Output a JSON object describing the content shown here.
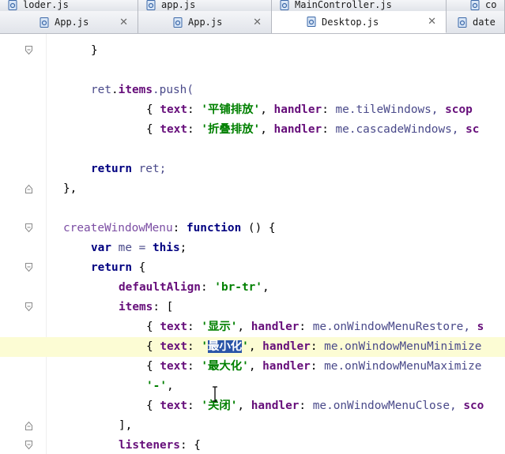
{
  "tabs_top": [
    {
      "label": "loder.js"
    },
    {
      "label": "app.js"
    },
    {
      "label": "MainController.js"
    },
    {
      "label": "co"
    }
  ],
  "tabs": [
    {
      "label": "App.js",
      "close": "✕"
    },
    {
      "label": "App.js",
      "close": "✕"
    },
    {
      "label": "Desktop.js",
      "close": "✕",
      "active": true
    },
    {
      "label": "date"
    }
  ],
  "code": {
    "l1": {
      "a": "}"
    },
    "l3": {
      "a": "ret",
      "b": ".",
      "c": "items",
      "d": ".push("
    },
    "l4": {
      "a": "{ ",
      "b": "text",
      "c": ": ",
      "d": "'平铺排放'",
      "e": ", ",
      "f": "handler",
      "g": ": ",
      "h": "me",
      "i": ".tileWindows, ",
      "j": "scop"
    },
    "l5": {
      "a": "{ ",
      "b": "text",
      "c": ": ",
      "d": "'折叠排放'",
      "e": ", ",
      "f": "handler",
      "g": ": ",
      "h": "me",
      "i": ".cascadeWindows, ",
      "j": "sc"
    },
    "l7": {
      "a": "return",
      "b": " ret;"
    },
    "l8": {
      "a": "},"
    },
    "l10": {
      "a": "createWindowMenu",
      "b": ": ",
      "c": "function",
      "d": " () {"
    },
    "l11": {
      "a": "var",
      "b": " me = ",
      "c": "this",
      "d": ";"
    },
    "l12": {
      "a": "return",
      "b": " {"
    },
    "l13": {
      "a": "defaultAlign",
      "b": ": ",
      "c": "'br-tr'",
      "d": ","
    },
    "l14": {
      "a": "items",
      "b": ": ["
    },
    "l15": {
      "a": "{ ",
      "b": "text",
      "c": ": ",
      "d": "'显示'",
      "e": ", ",
      "f": "handler",
      "g": ": ",
      "h": "me",
      "i": ".onWindowMenuRestore, ",
      "j": "s"
    },
    "l16": {
      "a": "{ ",
      "b": "text",
      "c": ": ",
      "d1": "'",
      "d2": "最小化",
      "d3": "'",
      "e": ", ",
      "f": "handler",
      "g": ": ",
      "h": "me",
      "i": ".onWindowMenuMinimize"
    },
    "l17": {
      "a": "{ ",
      "b": "text",
      "c": ": ",
      "d": "'最大化'",
      "e": ", ",
      "f": "handler",
      "g": ": ",
      "h": "me",
      "i": ".onWindowMenuMaximize"
    },
    "l18": {
      "a": "'-'",
      "b": ","
    },
    "l19": {
      "a": "{ ",
      "b": "text",
      "c": ": ",
      "d": "'关闭'",
      "e": ", ",
      "f": "handler",
      "g": ": ",
      "h": "me",
      "i": ".onWindowMenuClose, ",
      "j": "sco"
    },
    "l20": {
      "a": "],"
    },
    "l21": {
      "a": "listeners",
      "b": ": {"
    }
  },
  "icons": {
    "file": "js-file-icon",
    "fold": "code-fold-marker-icon",
    "cursor": "text-cursor-ibeam-icon"
  },
  "colors": {
    "keyword": "#000080",
    "property": "#660e7a",
    "string": "#008000",
    "selection": "#2a55a8",
    "current_line": "#fcfcd4"
  }
}
